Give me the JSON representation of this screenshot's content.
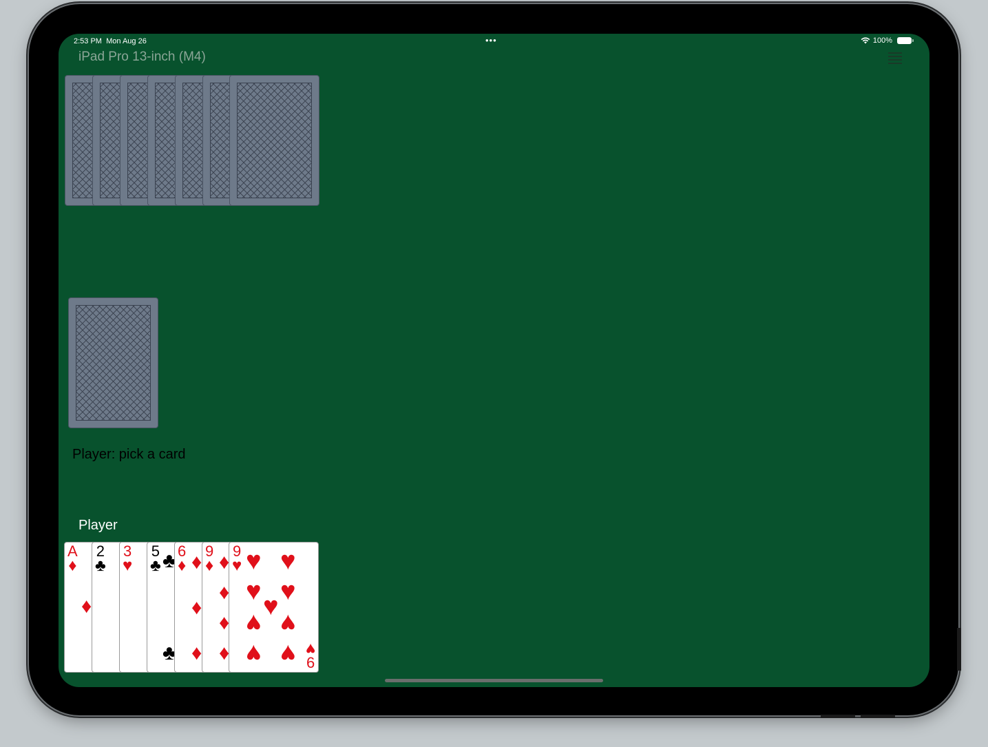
{
  "status_bar": {
    "time": "2:53 PM",
    "date": "Mon Aug 26",
    "dots": "•••",
    "battery": "100%",
    "icons": [
      "wifi-icon",
      "battery-icon"
    ]
  },
  "app": {
    "device_title": "iPad Pro 13-inch (M4)",
    "menu_icon": "hamburger-menu-icon"
  },
  "opponent_hand": {
    "card_count": 7,
    "face": "down"
  },
  "draw_pile": {
    "face": "down"
  },
  "game_status": "Player: pick a card",
  "player": {
    "label": "Player",
    "hand": [
      {
        "rank": "A",
        "suit": "♦",
        "color": "red"
      },
      {
        "rank": "2",
        "suit": "♣",
        "color": "black"
      },
      {
        "rank": "3",
        "suit": "♥",
        "color": "red"
      },
      {
        "rank": "5",
        "suit": "♣",
        "color": "black"
      },
      {
        "rank": "6",
        "suit": "♦",
        "color": "red"
      },
      {
        "rank": "9",
        "suit": "♦",
        "color": "red"
      },
      {
        "rank": "9",
        "suit": "♥",
        "color": "red"
      }
    ],
    "last_card_corner_bottom": "6"
  },
  "colors": {
    "table": "#08522d",
    "card_back": "#6e7a8a",
    "red_suit": "#e0101a",
    "black_suit": "#000000"
  }
}
